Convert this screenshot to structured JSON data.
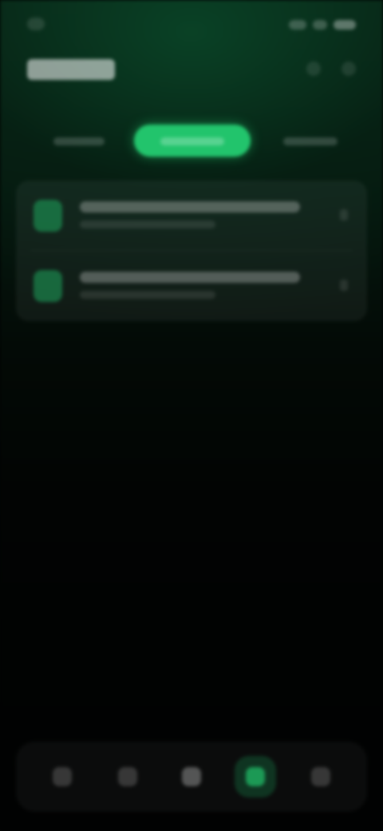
{
  "status_bar": {
    "time": "",
    "icons": [
      "signal-icon",
      "wifi-icon",
      "battery-icon"
    ]
  },
  "header": {
    "title": "",
    "actions": [
      "search-icon",
      "more-icon"
    ]
  },
  "tabs": [
    {
      "label": "",
      "selected": false
    },
    {
      "label": "",
      "selected": true
    },
    {
      "label": "",
      "selected": false
    }
  ],
  "list": {
    "items": [
      {
        "title": "",
        "subtitle": "",
        "icon": "item-icon"
      },
      {
        "title": "",
        "subtitle": "",
        "icon": "item-icon"
      }
    ]
  },
  "bottom_nav": {
    "items": [
      {
        "label": "",
        "icon": "home-icon",
        "active": false
      },
      {
        "label": "",
        "icon": "explore-icon",
        "active": false
      },
      {
        "label": "",
        "icon": "add-icon",
        "active": false
      },
      {
        "label": "",
        "icon": "activity-icon",
        "active": true
      },
      {
        "label": "",
        "icon": "profile-icon",
        "active": false
      }
    ]
  },
  "colors": {
    "accent": "#22c46c",
    "background_top": "#0a2a1a",
    "background_bottom": "#010202"
  }
}
